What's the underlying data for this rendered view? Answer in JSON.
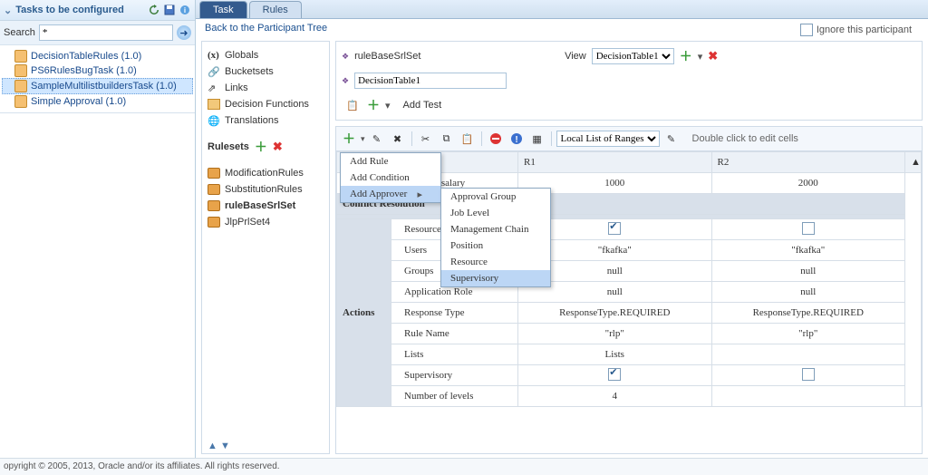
{
  "left": {
    "title": "Tasks to be configured",
    "search_label": "Search",
    "search_value": "*",
    "tree": [
      {
        "label": "DecisionTableRules (1.0)"
      },
      {
        "label": "PS6RulesBugTask (1.0)"
      },
      {
        "label": "SampleMultilistbuildersTask (1.0)",
        "selected": true
      },
      {
        "label": "Simple Approval (1.0)"
      }
    ]
  },
  "ignore_label": "Ignore this participant",
  "tabs": {
    "active": "Task",
    "other": "Rules"
  },
  "backlink": "Back to the Participant Tree",
  "inner_left": {
    "items": [
      {
        "label": "Globals",
        "icon": "x"
      },
      {
        "label": "Bucketsets",
        "icon": "clip"
      },
      {
        "label": "Links",
        "icon": "link"
      },
      {
        "label": "Decision Functions",
        "icon": "df"
      },
      {
        "label": "Translations",
        "icon": "tr"
      }
    ],
    "rulesets_label": "Rulesets",
    "rulesets": [
      {
        "label": "ModificationRules"
      },
      {
        "label": "SubstitutionRules"
      },
      {
        "label": "ruleBaseSrlSet",
        "bold": true
      },
      {
        "label": "JlpPrlSet4"
      }
    ]
  },
  "ir_top": {
    "ruleBase": "ruleBaseSrlSet",
    "view_label": "View",
    "view_value": "DecisionTable1",
    "decisionTable": "DecisionTable1",
    "add_test": "Add Test"
  },
  "toolbar": {
    "range_select": "Local List of Ranges",
    "hint": "Double click to edit cells"
  },
  "grid": {
    "rule_cols": [
      "R1",
      "R2"
    ],
    "cond_header": "ad.process.salary",
    "cond_values": [
      "1000",
      "2000"
    ],
    "conflict": "Conflict Resolution",
    "actions": "Actions",
    "rows": [
      {
        "label": "Resource",
        "type": "check",
        "v": [
          "on",
          "off"
        ]
      },
      {
        "label": "Users",
        "type": "text",
        "v": [
          "\"fkafka\"",
          "\"fkafka\""
        ]
      },
      {
        "label": "Groups",
        "type": "text",
        "v": [
          "null",
          "null"
        ]
      },
      {
        "label": "Application Role",
        "type": "text",
        "v": [
          "null",
          "null"
        ]
      },
      {
        "label": "Response Type",
        "type": "text",
        "v": [
          "ResponseType.REQUIRED",
          "ResponseType.REQUIRED"
        ]
      },
      {
        "label": "Rule Name",
        "type": "text",
        "v": [
          "\"rlp\"",
          "\"rlp\""
        ]
      },
      {
        "label": "Lists",
        "type": "text",
        "v": [
          "Lists",
          ""
        ]
      },
      {
        "label": "Supervisory",
        "type": "check",
        "v": [
          "on",
          "off"
        ]
      },
      {
        "label": "Number of levels",
        "type": "text",
        "v": [
          "4",
          ""
        ]
      }
    ]
  },
  "menu": {
    "items": [
      "Add Rule",
      "Add Condition",
      "Add Approver"
    ],
    "highlight": 2,
    "sub": [
      "Approval Group",
      "Job Level",
      "Management Chain",
      "Position",
      "Resource",
      "Supervisory"
    ],
    "sub_highlight": 5
  },
  "footer": "opyright © 2005, 2013, Oracle and/or its affiliates. All rights reserved."
}
